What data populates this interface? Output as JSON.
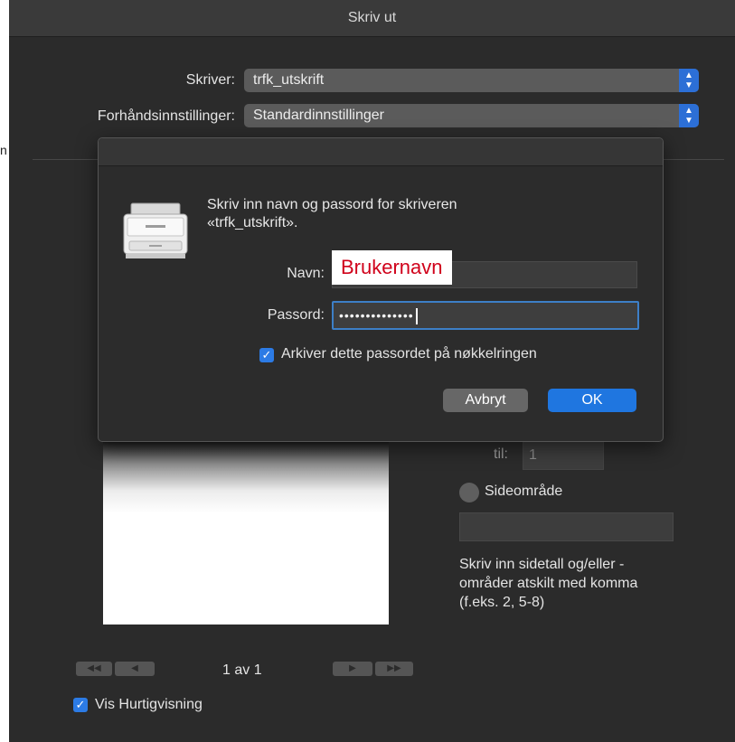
{
  "fragment_text": "n",
  "window": {
    "title": "Skriv ut"
  },
  "printer_row": {
    "label": "Skriver:",
    "value": "trfk_utskrift"
  },
  "presets_row": {
    "label": "Forhåndsinnstillinger:",
    "value": "Standardinnstillinger"
  },
  "auth_dialog": {
    "prompt_line1": "Skriv inn navn og passord for skriveren",
    "prompt_line2": "«trfk_utskrift».",
    "name_label": "Navn:",
    "name_overlay": "Brukernavn",
    "password_label": "Passord:",
    "password_value": "••••••••••••••",
    "keychain_checkbox": {
      "label": "Arkiver dette passordet på nøkkelringen",
      "checked": true
    },
    "cancel_label": "Avbryt",
    "ok_label": "OK"
  },
  "pages": {
    "to_label": "til:",
    "to_value": "1",
    "range_label": "Sideområde",
    "help_text": "Skriv inn sidetall og/eller -områder atskilt med komma (f.eks. 2, 5-8)"
  },
  "preview": {
    "page_count": "1 av 1",
    "first_icon": "double-left-arrow",
    "prev_icon": "left-arrow",
    "next_icon": "right-arrow",
    "last_icon": "double-right-arrow"
  },
  "quicklook_checkbox": {
    "label": "Vis Hurtigvisning",
    "checked": true
  },
  "colors": {
    "accent": "#2c7be5",
    "overlay_text": "#d0021b",
    "window_bg": "#2b2b2b"
  }
}
